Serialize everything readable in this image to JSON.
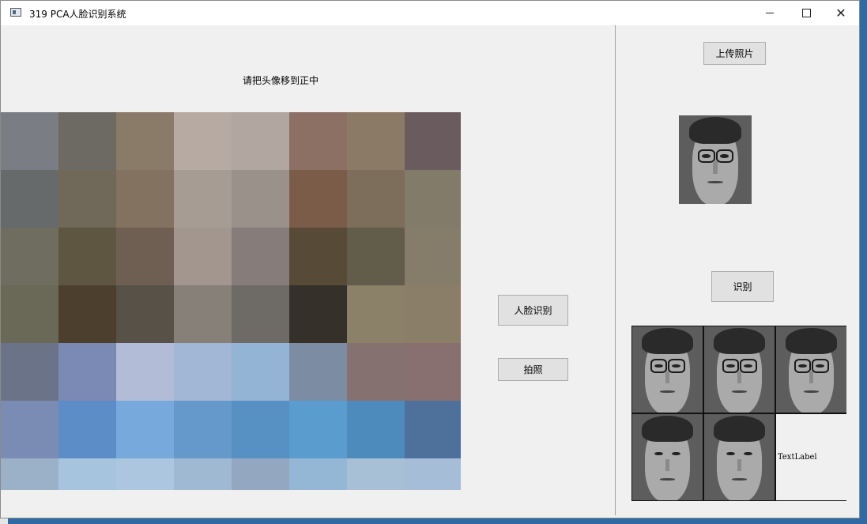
{
  "window": {
    "title": "319 PCA人脸识别系统"
  },
  "main": {
    "hint_text": "请把头像移到正中",
    "camera_view": {
      "pixelated": true,
      "colors": [
        [
          "#7a7d84",
          "#6c6a62",
          "#8a7a68",
          "#b6aaa3",
          "#b1a7a0",
          "#8c7064",
          "#8a7a66",
          "#6a5c5e"
        ],
        [
          "#676a6b",
          "#706858",
          "#82725f",
          "#a69c94",
          "#9b918b",
          "#7a5c48",
          "#7c6e5a",
          "#837b69"
        ],
        [
          "#6e6d5f",
          "#5e5640",
          "#6e5f52",
          "#a3968f",
          "#867c7a",
          "#574a37",
          "#625c4a",
          "#857d69"
        ],
        [
          "#6a6856",
          "#4c3f2e",
          "#575147",
          "#878078",
          "#6e6a66",
          "#35302a",
          "#8b8068",
          "#8a7e68"
        ],
        [
          "#6b7389",
          "#7b8ab5",
          "#b2bcd6",
          "#a2b6d6",
          "#94b4d5",
          "#7b8ca3",
          "#867171",
          "#887071"
        ],
        [
          "#7a8cb4",
          "#5c8dc7",
          "#78a9dd",
          "#6598cb",
          "#5790c3",
          "#5a9ccd",
          "#4d8bbd",
          "#4e719b"
        ],
        [
          "#9bb1c8",
          "#a7c4df",
          "#acc6df",
          "#a0b9d2",
          "#93a8c0",
          "#93b7d4",
          "#a7c0d6",
          "#a5bdd6"
        ]
      ]
    },
    "face_recognition_button": "人脸识别",
    "take_photo_button": "拍照"
  },
  "right_panel": {
    "upload_photo_button": "上传照片",
    "recognize_button": "识别",
    "results": {
      "faces": [
        {
          "glasses": true
        },
        {
          "glasses": true
        },
        {
          "glasses": true
        },
        {
          "glasses": false
        },
        {
          "glasses": false
        }
      ],
      "text_label": "TextLabel"
    }
  }
}
